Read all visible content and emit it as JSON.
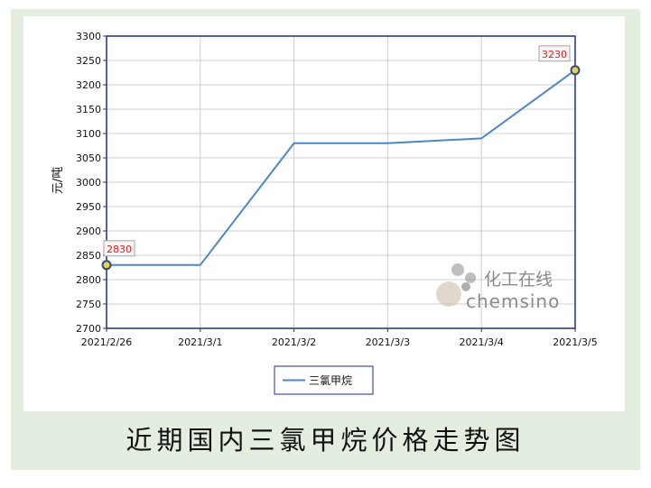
{
  "caption": "近期国内三氯甲烷价格走势图",
  "colors": {
    "line": "#4a86c8",
    "marker_fill": "#e8d24a",
    "marker_stroke": "#2f4a8a",
    "label_text": "#e02020",
    "plot_border": "#1c2f8a",
    "grid": "#cfcfcf",
    "background_frame": "#e3eee0"
  },
  "watermark": {
    "icon": "molecule-logo-icon",
    "cn_text": "化工在线",
    "en_text": "chemsino"
  },
  "chart_data": {
    "type": "line",
    "title": "",
    "xlabel": "",
    "ylabel": "元/吨",
    "x": [
      "2021/2/26",
      "2021/3/1",
      "2021/3/2",
      "2021/3/3",
      "2021/3/4",
      "2021/3/5"
    ],
    "series": [
      {
        "name": "三氯甲烷",
        "values": [
          2830,
          2830,
          3080,
          3080,
          3090,
          3230
        ]
      }
    ],
    "ylim": [
      2700,
      3300
    ],
    "yticks": [
      2700,
      2750,
      2800,
      2850,
      2900,
      2950,
      3000,
      3050,
      3100,
      3150,
      3200,
      3250,
      3300
    ],
    "point_labels": [
      {
        "index": 0,
        "text": "2830"
      },
      {
        "index": 5,
        "text": "3230"
      }
    ],
    "grid": true,
    "legend": "bottom-center"
  }
}
